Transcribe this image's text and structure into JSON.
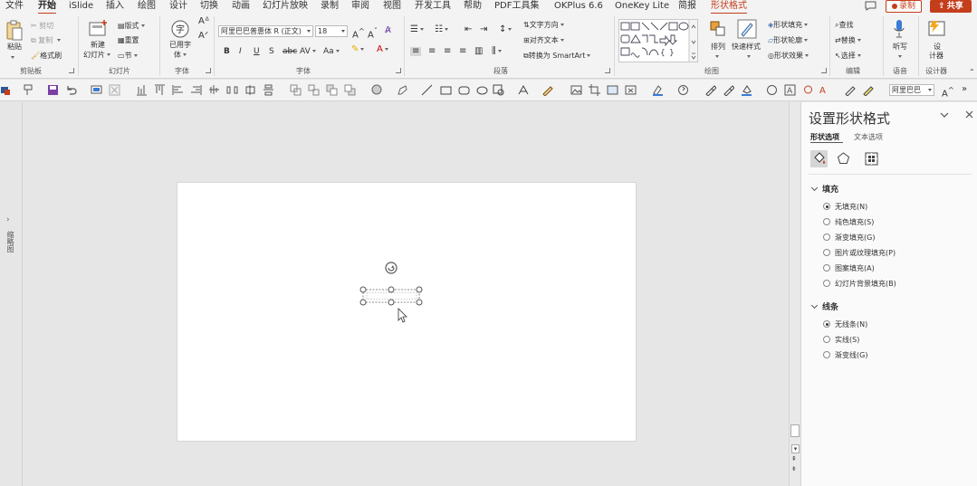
{
  "menu": {
    "tabs": [
      "文件",
      "开始",
      "iSlide",
      "插入",
      "绘图",
      "设计",
      "切换",
      "动画",
      "幻灯片放映",
      "录制",
      "审阅",
      "视图",
      "开发工具",
      "帮助",
      "PDF工具集",
      "OKPlus 6.6",
      "OneKey Lite",
      "简报",
      "形状格式"
    ],
    "active_tab": "开始",
    "context_tab": "形状格式",
    "record_label": "录制",
    "share_label": "共享"
  },
  "ribbon": {
    "clipboard": {
      "paste": "粘贴",
      "cut": "剪切",
      "copy": "复制",
      "format_painter": "格式刷",
      "group": "剪贴板"
    },
    "slides": {
      "new_slide_1": "新建",
      "new_slide_2": "幻灯片",
      "layout": "版式",
      "reset": "重置",
      "section": "节",
      "group": "幻灯片"
    },
    "font_group_a": {
      "used_fonts_1": "已用字",
      "used_fonts_2": "体",
      "group": "字体"
    },
    "font": {
      "name": "阿里巴巴普惠体 R (正文)",
      "size": "18",
      "group": "字体"
    },
    "paragraph": {
      "text_direction": "文字方向",
      "align_text": "对齐文本",
      "smartart": "转换为 SmartArt",
      "group": "段落"
    },
    "drawing": {
      "arrange": "排列",
      "quick_styles": "快速样式",
      "shape_fill": "形状填充",
      "shape_outline": "形状轮廓",
      "shape_effects": "形状效果",
      "group": "绘图"
    },
    "editing": {
      "find": "查找",
      "replace": "替换",
      "select": "选择",
      "group": "编辑"
    },
    "voice": {
      "dictate": "听写",
      "group": "语音"
    },
    "designer": {
      "designer_1": "设",
      "designer_2": "计器",
      "group": "设计器"
    }
  },
  "qat": {
    "font_name": "阿里巴巴"
  },
  "thumb_rail": {
    "label": "缩略图"
  },
  "pane": {
    "title": "设置形状格式",
    "tab_shape": "形状选项",
    "tab_text": "文本选项",
    "fill": {
      "heading": "填充",
      "options": [
        {
          "label": "无填充(N)",
          "selected": true
        },
        {
          "label": "纯色填充(S)",
          "selected": false
        },
        {
          "label": "渐变填充(G)",
          "selected": false
        },
        {
          "label": "图片或纹理填充(P)",
          "selected": false
        },
        {
          "label": "图案填充(A)",
          "selected": false
        },
        {
          "label": "幻灯片背景填充(B)",
          "selected": false
        }
      ]
    },
    "line": {
      "heading": "线条",
      "options": [
        {
          "label": "无线条(N)",
          "selected": true
        },
        {
          "label": "实线(S)",
          "selected": false
        },
        {
          "label": "渐变线(G)",
          "selected": false
        }
      ]
    }
  },
  "colors": {
    "accent": "#c43e1c",
    "ribbon_bg": "#f3f3f3",
    "canvas_bg": "#e6e6e6"
  }
}
